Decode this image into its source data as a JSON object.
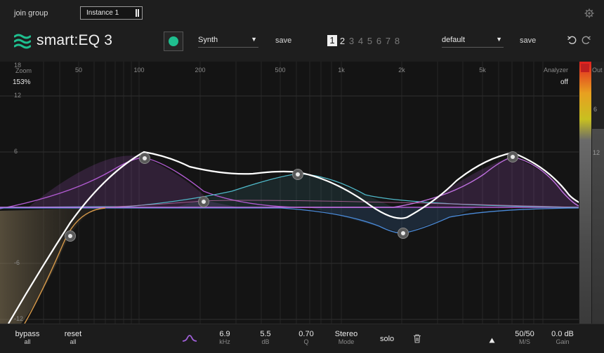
{
  "topbar": {
    "join_group": "join group",
    "instance": "Instance 1"
  },
  "header": {
    "logo": "smart:EQ 3",
    "profile": "Synth",
    "save_left": "save",
    "slots": [
      "1",
      "2",
      "3",
      "4",
      "5",
      "6",
      "7",
      "8"
    ],
    "active_slot": "1",
    "preset": "default",
    "save_right": "save"
  },
  "graph": {
    "zoom_label": "Zoom",
    "zoom_value": "153%",
    "analyzer_label": "Analyzer",
    "analyzer_value": "off",
    "out_label": "Out",
    "freq_labels": [
      "50",
      "100",
      "200",
      "500",
      "1k",
      "2k",
      "5k"
    ],
    "db_labels": [
      "18",
      "12",
      "6",
      "-6",
      "-12"
    ],
    "meter_labels": [
      "6",
      "12"
    ],
    "colors": {
      "main_curve": "#ffffff",
      "band_purple": "#b05ad0",
      "band_cyan": "#4fb8c8",
      "band_blue": "#4a8ad8",
      "band_orange": "#d89a4a"
    }
  },
  "bottom": {
    "bypass": "bypass",
    "bypass_sub": "all",
    "reset": "reset",
    "reset_sub": "all",
    "freq": "6.9",
    "freq_unit": "kHz",
    "gain": "5.5",
    "gain_unit": "dB",
    "q": "0.70",
    "q_unit": "Q",
    "mode": "Stereo",
    "mode_unit": "Mode",
    "solo": "solo",
    "ms": "50/50",
    "ms_unit": "M/S",
    "out_gain": "0.0 dB",
    "out_gain_unit": "Gain"
  }
}
